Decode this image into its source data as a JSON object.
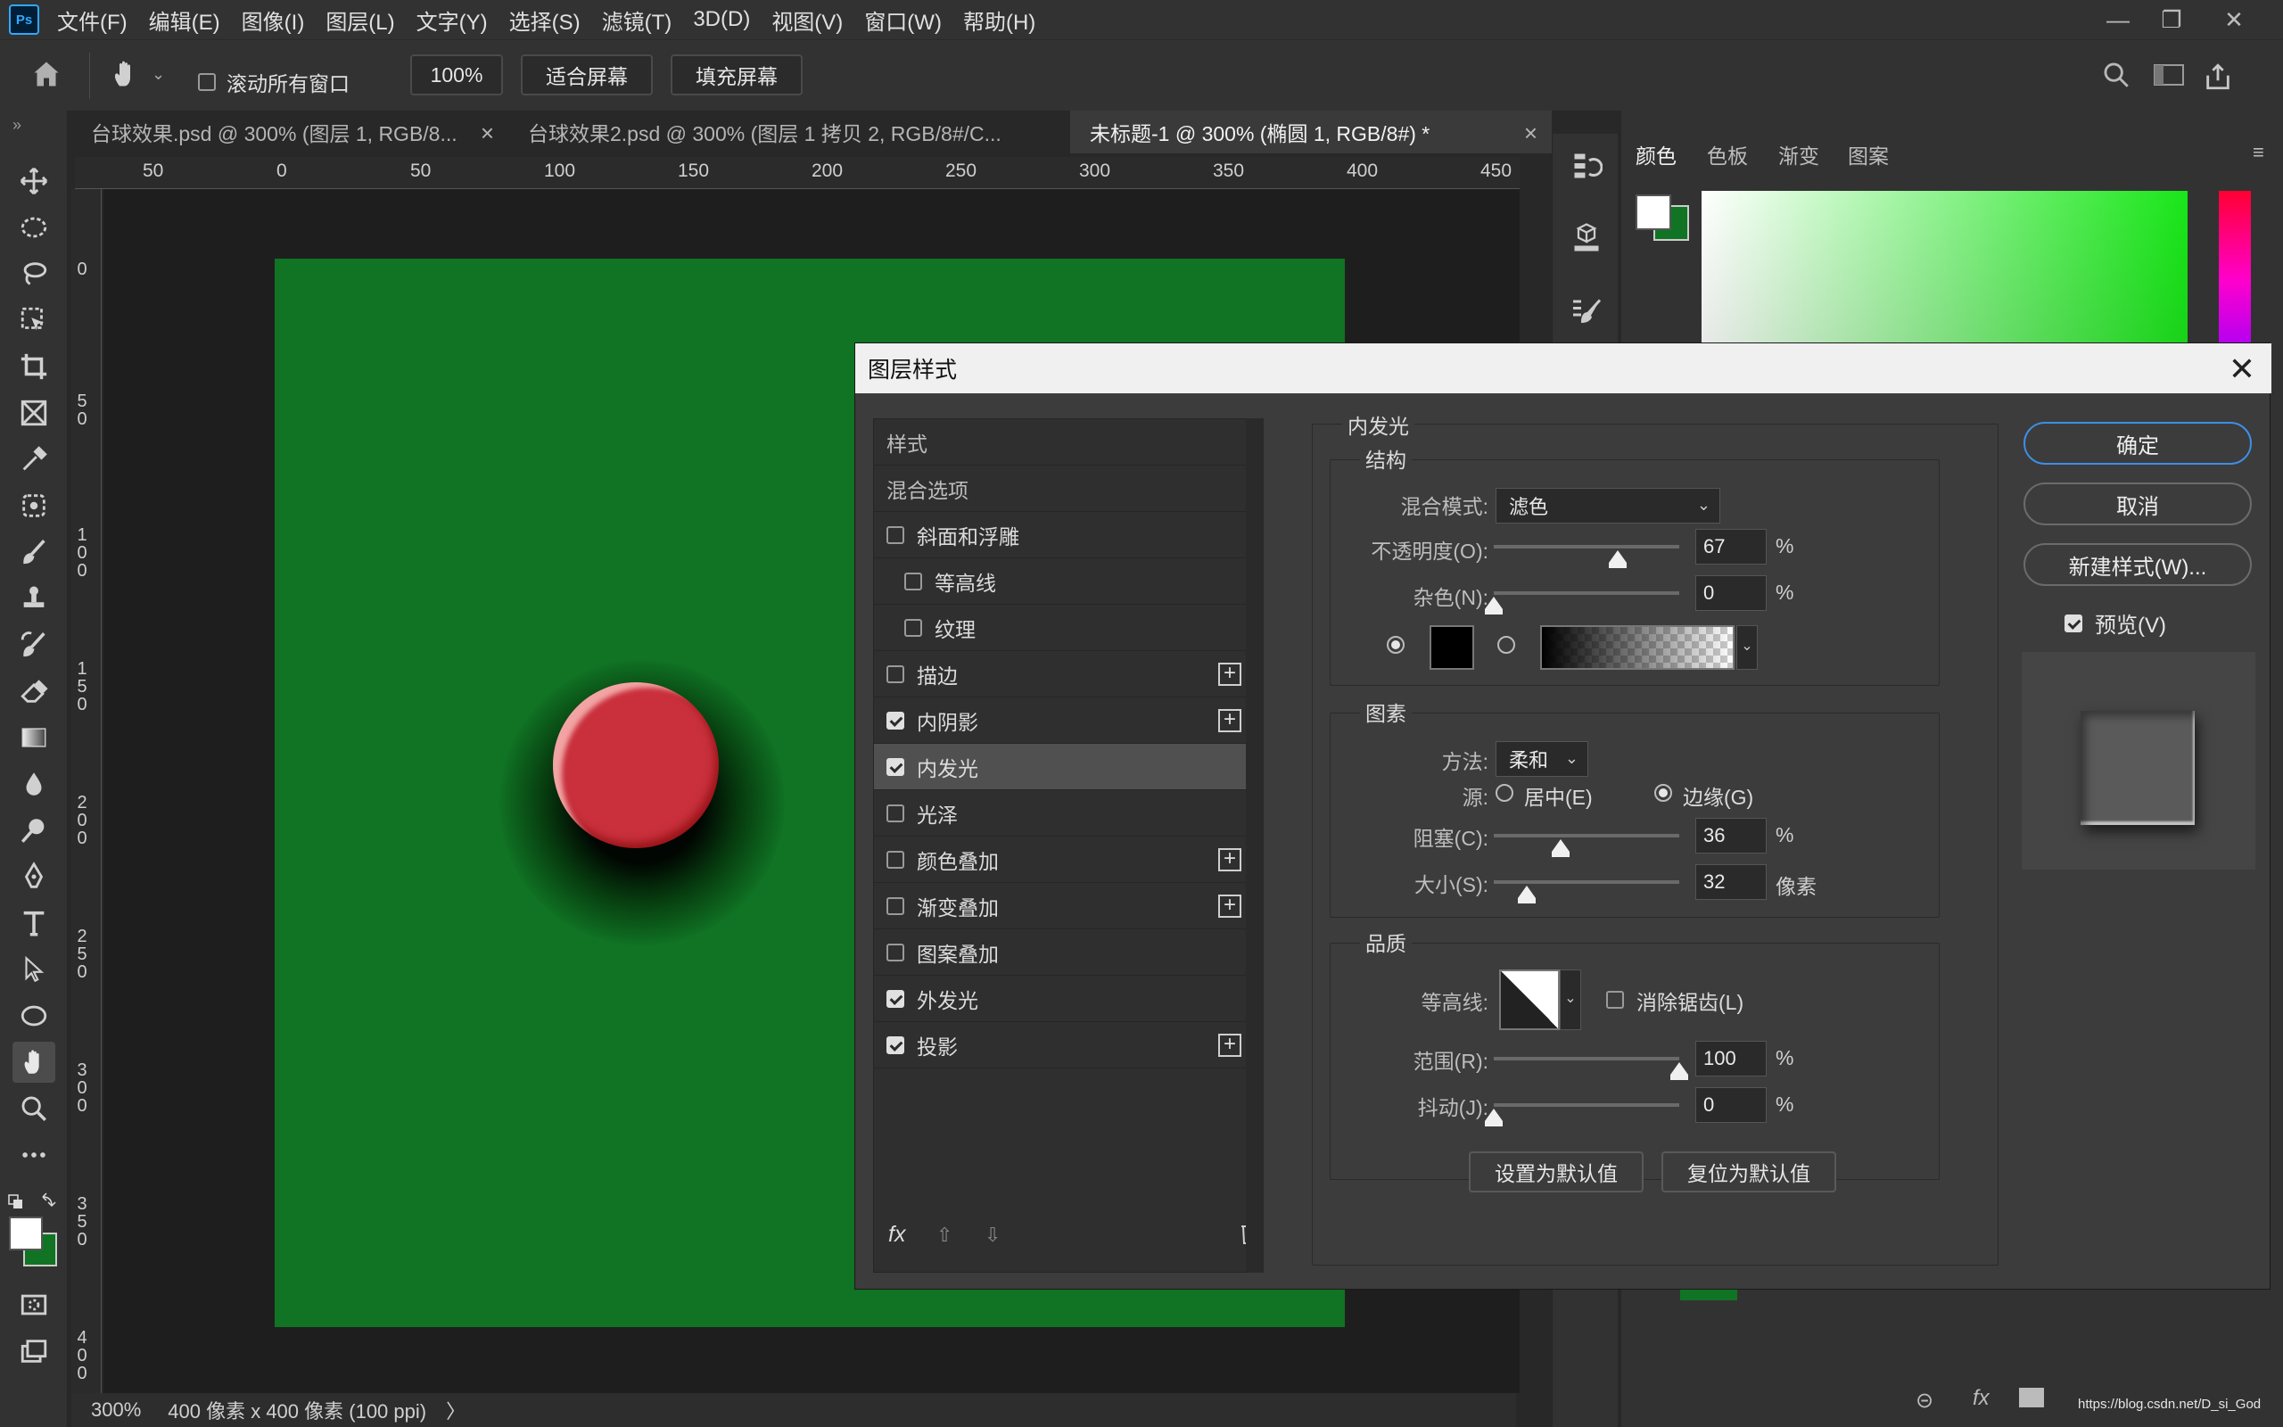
{
  "app": {
    "logo": "Ps"
  },
  "menu": [
    "文件(F)",
    "编辑(E)",
    "图像(I)",
    "图层(L)",
    "文字(Y)",
    "选择(S)",
    "滤镜(T)",
    "3D(D)",
    "视图(V)",
    "窗口(W)",
    "帮助(H)"
  ],
  "window_controls": {
    "minimize": "—",
    "restore": "❐",
    "close": "✕"
  },
  "options_bar": {
    "scroll_all_label": "滚动所有窗口",
    "zoom_value": "100%",
    "fit_screen": "适合屏幕",
    "fill_screen": "填充屏幕"
  },
  "tabs": [
    {
      "label": "台球效果.psd @ 300% (图层 1, RGB/8...",
      "close": "×"
    },
    {
      "label": "台球效果2.psd @ 300% (图层 1 拷贝 2, RGB/8#/C...",
      "close": "×"
    },
    {
      "label": "未标题-1 @ 300% (椭圆 1, RGB/8#) *",
      "close": "×"
    }
  ],
  "ruler_top": [
    "50",
    "0",
    "50",
    "100",
    "150",
    "200",
    "250",
    "300",
    "350",
    "400",
    "450"
  ],
  "ruler_left": [
    "0",
    "5\n0",
    "1\n0\n0",
    "1\n5\n0",
    "2\n0\n0",
    "2\n5\n0",
    "3\n0\n0",
    "3\n5\n0",
    "4\n0\n0"
  ],
  "status": {
    "zoom": "300%",
    "doc_info": "400 像素 x 400 像素 (100 ppi)",
    "arrow": "〉"
  },
  "color_panel": {
    "tabs": [
      "颜色",
      "色板",
      "渐变",
      "图案"
    ],
    "foreground": "#ffffff",
    "background": "#107424"
  },
  "dialog": {
    "title": "图层样式",
    "close": "✕",
    "styles_header": "样式",
    "blend_options": "混合选项",
    "items": [
      {
        "label": "斜面和浮雕",
        "checked": false,
        "indent": false,
        "plus": false
      },
      {
        "label": "等高线",
        "checked": false,
        "indent": true,
        "plus": false
      },
      {
        "label": "纹理",
        "checked": false,
        "indent": true,
        "plus": false
      },
      {
        "label": "描边",
        "checked": false,
        "indent": false,
        "plus": true
      },
      {
        "label": "内阴影",
        "checked": true,
        "indent": false,
        "plus": true
      },
      {
        "label": "内发光",
        "checked": true,
        "indent": false,
        "plus": false,
        "selected": true
      },
      {
        "label": "光泽",
        "checked": false,
        "indent": false,
        "plus": false
      },
      {
        "label": "颜色叠加",
        "checked": false,
        "indent": false,
        "plus": true
      },
      {
        "label": "渐变叠加",
        "checked": false,
        "indent": false,
        "plus": true
      },
      {
        "label": "图案叠加",
        "checked": false,
        "indent": false,
        "plus": false
      },
      {
        "label": "外发光",
        "checked": true,
        "indent": false,
        "plus": false
      },
      {
        "label": "投影",
        "checked": true,
        "indent": false,
        "plus": true
      }
    ],
    "fx_label": "fx",
    "section_title": "内发光",
    "structure": {
      "title": "结构",
      "blend_mode_label": "混合模式:",
      "blend_mode_value": "滤色",
      "opacity_label": "不透明度(O):",
      "opacity_value": "67",
      "opacity_unit": "%",
      "opacity_pct": 67,
      "noise_label": "杂色(N):",
      "noise_value": "0",
      "noise_unit": "%",
      "noise_pct": 0
    },
    "elements": {
      "title": "图素",
      "method_label": "方法:",
      "method_value": "柔和",
      "source_label": "源:",
      "center_label": "居中(E)",
      "edge_label": "边缘(G)",
      "choke_label": "阻塞(C):",
      "choke_value": "36",
      "choke_unit": "%",
      "choke_pct": 36,
      "size_label": "大小(S):",
      "size_value": "32",
      "size_unit": "像素",
      "size_pct": 18
    },
    "quality": {
      "title": "品质",
      "contour_label": "等高线:",
      "antialias_label": "消除锯齿(L)",
      "range_label": "范围(R):",
      "range_value": "100",
      "range_unit": "%",
      "range_pct": 100,
      "jitter_label": "抖动(J):",
      "jitter_value": "0",
      "jitter_unit": "%",
      "jitter_pct": 0
    },
    "set_default": "设置为默认值",
    "reset_default": "复位为默认值",
    "ok": "确定",
    "cancel": "取消",
    "new_style": "新建样式(W)...",
    "preview_label": "预览(V)"
  },
  "watermark": "https://blog.csdn.net/D_si_God"
}
